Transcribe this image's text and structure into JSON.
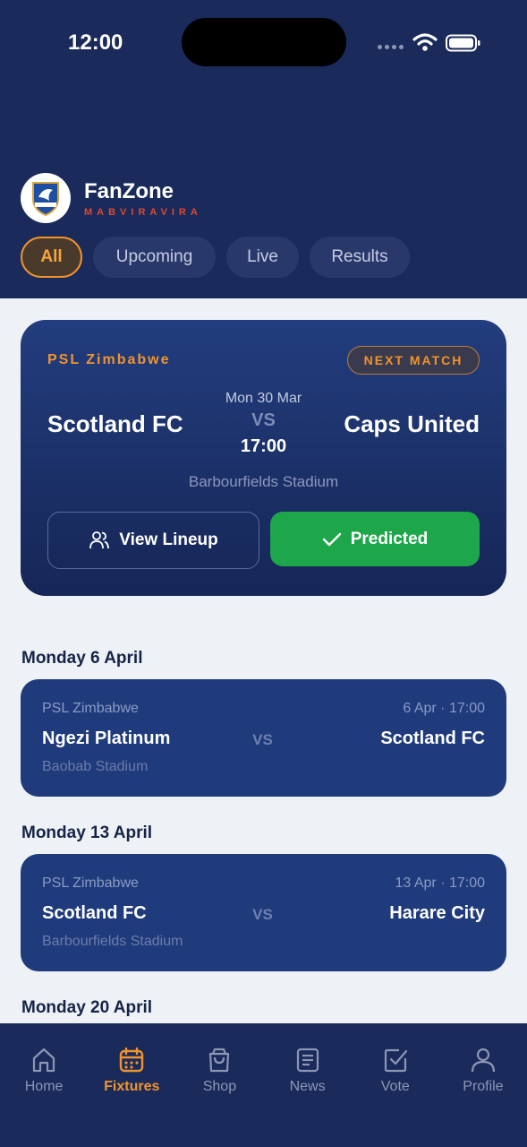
{
  "status_bar": {
    "time": "12:00"
  },
  "brand": {
    "name": "FanZone",
    "subtitle": "MABVIRAVIRA"
  },
  "filter_tabs": [
    {
      "label": "All",
      "active": true
    },
    {
      "label": "Upcoming",
      "active": false
    },
    {
      "label": "Live",
      "active": false
    },
    {
      "label": "Results",
      "active": false
    }
  ],
  "next_match": {
    "league": "PSL Zimbabwe",
    "badge": "NEXT MATCH",
    "home": "Scotland FC",
    "away": "Caps United",
    "date": "Mon 30 Mar",
    "vs": "VS",
    "time": "17:00",
    "venue": "Barbourfields Stadium",
    "lineup_label": "View Lineup",
    "predicted_label": "Predicted"
  },
  "fixture_groups": [
    {
      "heading": "Monday 6 April",
      "fixture": {
        "league": "PSL Zimbabwe",
        "datetime": "6 Apr · 17:00",
        "home": "Ngezi Platinum",
        "vs": "VS",
        "away": "Scotland FC",
        "venue": "Baobab Stadium"
      }
    },
    {
      "heading": "Monday 13 April",
      "fixture": {
        "league": "PSL Zimbabwe",
        "datetime": "13 Apr · 17:00",
        "home": "Scotland FC",
        "vs": "VS",
        "away": "Harare City",
        "venue": "Barbourfields Stadium"
      }
    },
    {
      "heading": "Monday 20 April"
    }
  ],
  "bottom_nav": [
    {
      "label": "Home",
      "icon": "home-icon",
      "active": false
    },
    {
      "label": "Fixtures",
      "icon": "calendar-icon",
      "active": true
    },
    {
      "label": "Shop",
      "icon": "shopping-bag-icon",
      "active": false
    },
    {
      "label": "News",
      "icon": "news-icon",
      "active": false
    },
    {
      "label": "Vote",
      "icon": "vote-checkbox-icon",
      "active": false
    },
    {
      "label": "Profile",
      "icon": "user-icon",
      "active": false
    }
  ],
  "colors": {
    "navy": "#1a2a5a",
    "accent_orange": "#f0942d",
    "green": "#1ea64b",
    "card_blue": "#1f3b7c",
    "background": "#eef2f7"
  }
}
